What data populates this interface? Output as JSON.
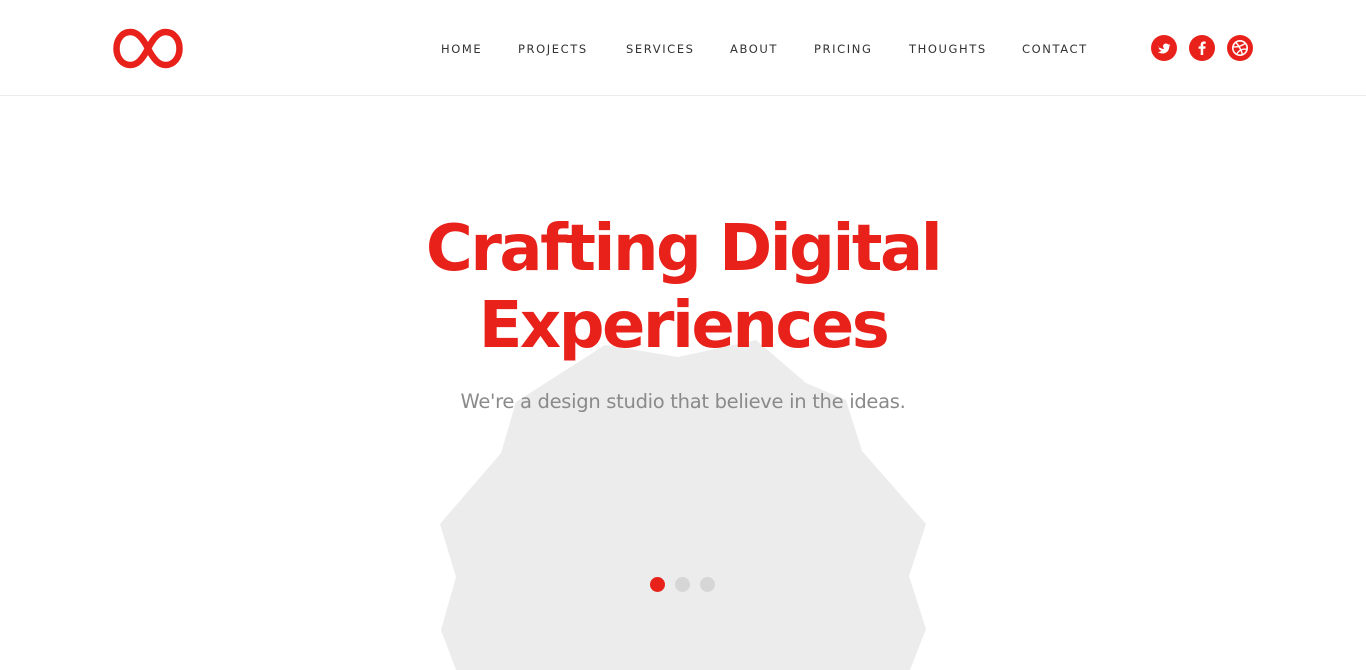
{
  "colors": {
    "accent": "#e8221b",
    "nav_text": "#333333",
    "subtitle": "#8a8a8a",
    "shape": "#ececec",
    "dot_inactive": "#d6d6d6"
  },
  "header": {
    "logo_icon": "infinity-logo",
    "nav": [
      {
        "label": "HOME"
      },
      {
        "label": "PROJECTS"
      },
      {
        "label": "SERVICES"
      },
      {
        "label": "ABOUT"
      },
      {
        "label": "PRICING"
      },
      {
        "label": "THOUGHTS"
      },
      {
        "label": "CONTACT"
      }
    ],
    "social": [
      {
        "icon": "twitter-icon"
      },
      {
        "icon": "facebook-icon"
      },
      {
        "icon": "dribbble-icon"
      }
    ]
  },
  "hero": {
    "title_line1": "Crafting Digital",
    "title_line2": "Experiences",
    "subtitle": "We're a design studio that believe in the ideas.",
    "slides": {
      "count": 3,
      "active": 1
    }
  }
}
